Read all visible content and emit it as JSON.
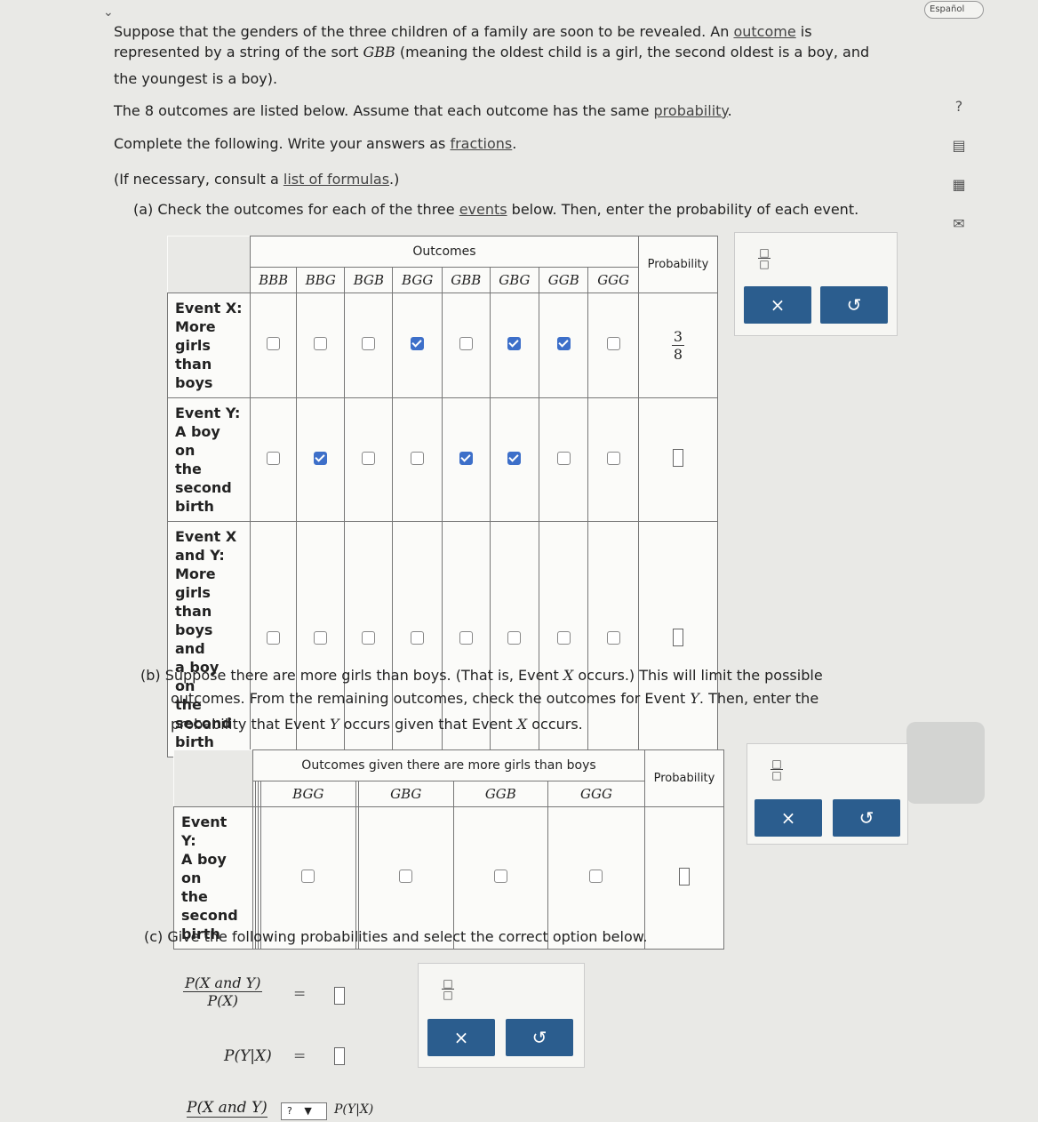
{
  "header": {
    "language": "Español"
  },
  "intro": {
    "line1_prefix": "Suppose that the genders of the three children of a family are soon to be revealed. An ",
    "line1_link": "outcome",
    "line1_suffix": " is",
    "line2_prefix": "represented by a string of the sort ",
    "line2_code": "GBB",
    "line2_suffix": " (meaning the oldest child is a girl, the second oldest is a boy, and",
    "line3": "the youngest is a boy).",
    "line4_prefix": "The 8 outcomes are listed below. Assume that each outcome has the same ",
    "line4_link": "probability",
    "line4_suffix": ".",
    "line5_prefix": "Complete the following. Write your answers as ",
    "line5_link": "fractions",
    "line5_suffix": ".",
    "line6_prefix": "(If necessary, consult a ",
    "line6_link": "list of formulas",
    "line6_suffix": ".)"
  },
  "part_a": {
    "instr_prefix": "(a) Check the outcomes for each of the three ",
    "instr_link": "events",
    "instr_suffix": " below. Then, enter the probability of each event.",
    "outcomes_header": "Outcomes",
    "probability_header": "Probability",
    "outcomes": [
      "BBB",
      "BBG",
      "BGB",
      "BGG",
      "GBB",
      "GBG",
      "GGB",
      "GGG"
    ],
    "rows": [
      {
        "label_lines": [
          "Event X:",
          "More",
          "girls than",
          "boys"
        ],
        "checked": [
          false,
          false,
          false,
          true,
          false,
          true,
          true,
          false
        ],
        "prob_num": "3",
        "prob_den": "8"
      },
      {
        "label_lines": [
          "Event Y:",
          "A boy on",
          "the",
          "second",
          "birth"
        ],
        "checked": [
          false,
          true,
          false,
          false,
          true,
          true,
          false,
          false
        ],
        "prob_num": "",
        "prob_den": ""
      },
      {
        "label_lines": [
          "Event X",
          "and Y:",
          "More",
          "girls than",
          "boys and",
          "a boy on",
          "the",
          "second",
          "birth"
        ],
        "checked": [
          false,
          false,
          false,
          false,
          false,
          false,
          false,
          false
        ],
        "prob_num": "",
        "prob_den": ""
      }
    ]
  },
  "part_b": {
    "line1_prefix": "(b) Suppose there are more girls than boys. (That is, Event ",
    "line1_x": "X",
    "line1_suffix": " occurs.) This will limit the possible",
    "line2_prefix": "outcomes. From the remaining outcomes, check the outcomes for Event ",
    "line2_y": "Y",
    "line2_suffix": ". Then, enter the",
    "line3_prefix": "probability that Event ",
    "line3_y": "Y",
    "line3_mid": " occurs given that Event ",
    "line3_x": "X",
    "line3_suffix": " occurs.",
    "outcomes_header": "Outcomes given there are more girls than boys",
    "probability_header": "Probability",
    "outcomes": [
      "",
      "",
      "",
      "BGG",
      "",
      "GBG",
      "GGB",
      "GGG"
    ],
    "row_label_lines": [
      "Event Y:",
      "A boy on",
      "the",
      "second",
      "birth"
    ],
    "row_boxes": [
      false,
      false,
      false,
      true,
      false,
      true,
      true,
      true
    ]
  },
  "part_c": {
    "instr": "(c) Give the following probabilities and select the correct option below.",
    "eq1_num": "P(X and Y)",
    "eq1_den": "P(X)",
    "eq_sign": "=",
    "eq2": "P(Y|X)",
    "eq3_left": "P(X and Y)",
    "dropdown_value": "?",
    "eq3_right": "P(Y|X)"
  },
  "keypad": {
    "clear": "×",
    "undo": "↺"
  }
}
